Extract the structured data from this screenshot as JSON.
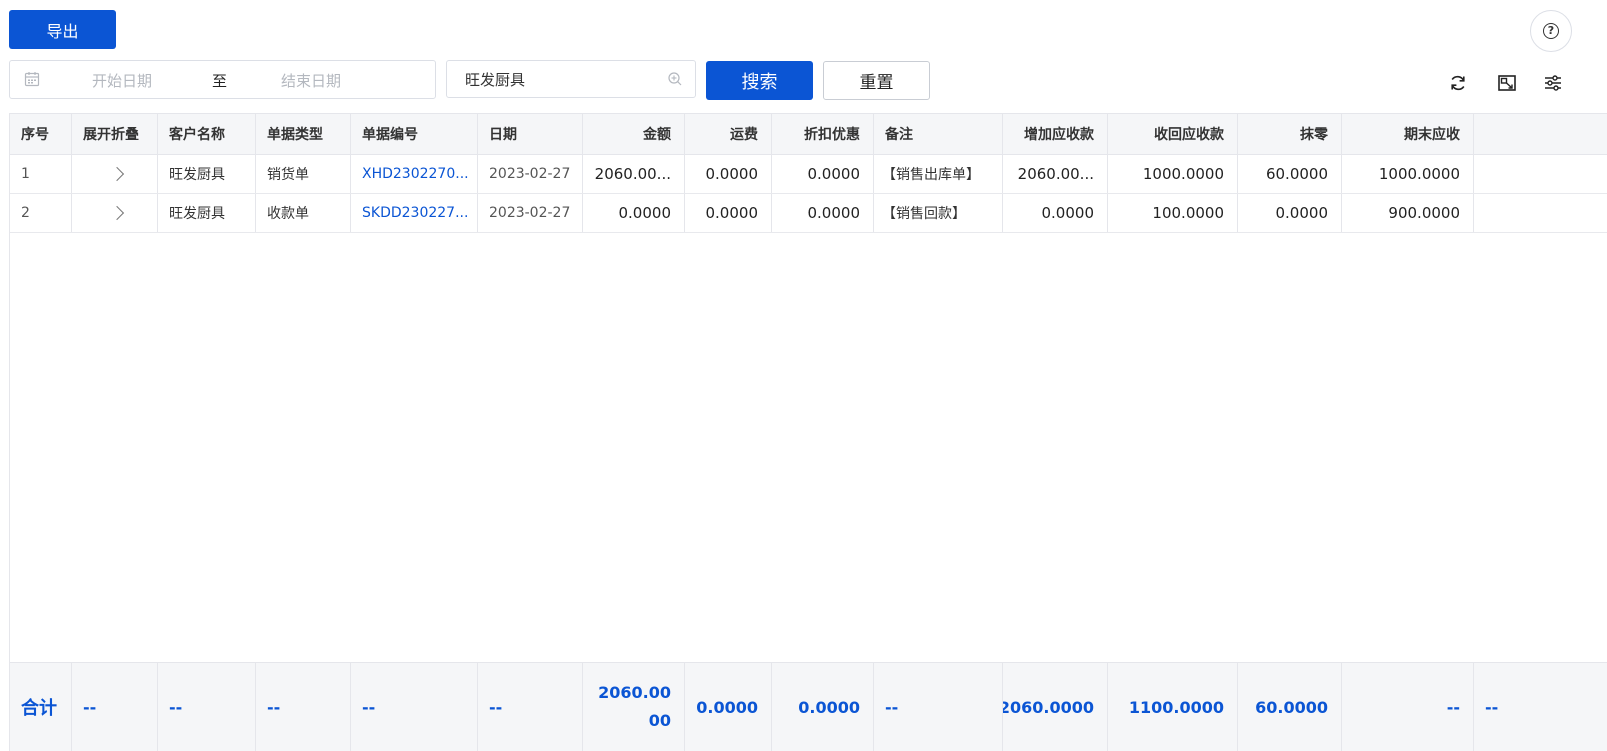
{
  "toolbar": {
    "export_label": "导出",
    "date_start_placeholder": "开始日期",
    "date_separator": "至",
    "date_end_placeholder": "结束日期",
    "customer_value": "旺发厨具",
    "search_label": "搜索",
    "reset_label": "重置"
  },
  "table": {
    "columns": [
      "序号",
      "展开折叠",
      "客户名称",
      "单据类型",
      "单据编号",
      "日期",
      "金额",
      "运费",
      "折扣优惠",
      "备注",
      "增加应收款",
      "收回应收款",
      "抹零",
      "期末应收",
      ""
    ],
    "rows": [
      {
        "index": "1",
        "customer": "旺发厨具",
        "doc_type": "销货单",
        "doc_no": "XHD2302270...",
        "date": "2023-02-27",
        "amount": "2060.00...",
        "freight": "0.0000",
        "discount": "0.0000",
        "remark": "【销售出库单】",
        "add_receivable": "2060.00...",
        "recover_receivable": "1000.0000",
        "round_off": "60.0000",
        "end_receivable": "1000.0000"
      },
      {
        "index": "2",
        "customer": "旺发厨具",
        "doc_type": "收款单",
        "doc_no": "SKDD230227...",
        "date": "2023-02-27",
        "amount": "0.0000",
        "freight": "0.0000",
        "discount": "0.0000",
        "remark": "【销售回款】",
        "add_receivable": "0.0000",
        "recover_receivable": "100.0000",
        "round_off": "0.0000",
        "end_receivable": "900.0000"
      }
    ],
    "footer": {
      "label": "合计",
      "dash": "--",
      "amount": "2060.0000",
      "freight": "0.0000",
      "discount": "0.0000",
      "add_receivable": "2060.0000",
      "recover_receivable": "1100.0000",
      "round_off": "60.0000"
    }
  },
  "colors": {
    "primary": "#0b55d4",
    "header_bg": "#f5f6f8",
    "border": "#e5e6eb"
  }
}
